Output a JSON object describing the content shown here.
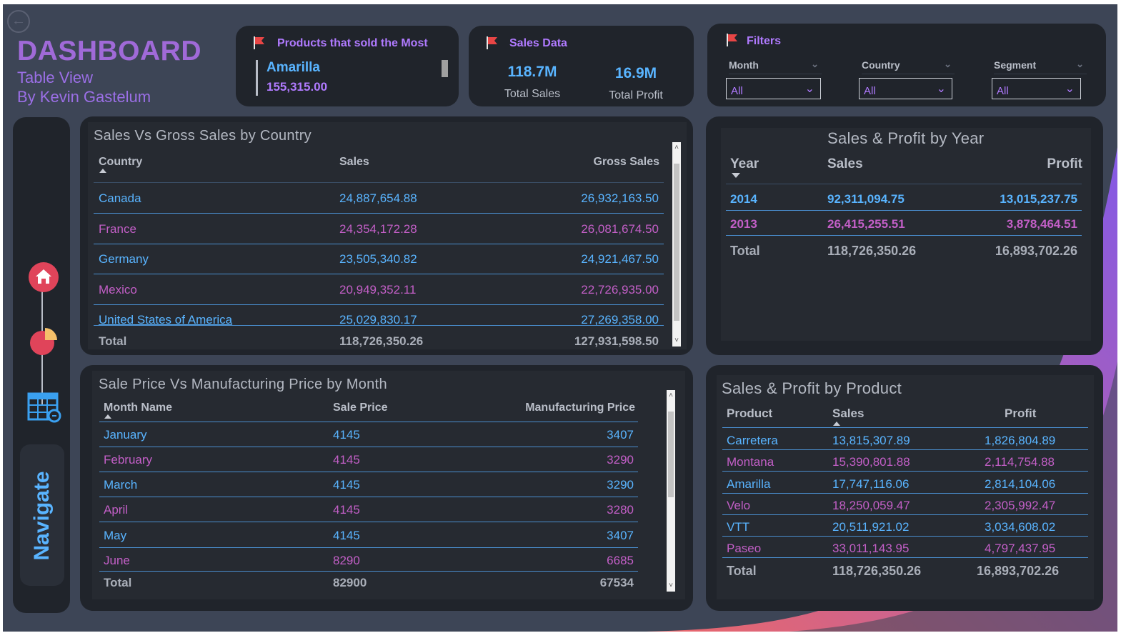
{
  "header": {
    "title": "DASHBOARD",
    "subtitle": "Table View",
    "author": "By Kevin Gastelum",
    "back_icon": "arrow-left-circle-icon"
  },
  "top_product": {
    "title": "Products that sold the Most",
    "name": "Amarilla",
    "value": "155,315.00"
  },
  "sales_data": {
    "title": "Sales Data",
    "total_sales_value": "118.7M",
    "total_sales_label": "Total Sales",
    "total_profit_value": "16.9M",
    "total_profit_label": "Total Profit"
  },
  "filters": {
    "title": "Filters",
    "items": [
      {
        "label": "Month",
        "value": "All"
      },
      {
        "label": "Country",
        "value": "All"
      },
      {
        "label": "Segment",
        "value": "All"
      }
    ]
  },
  "country_table": {
    "title": "Sales Vs Gross Sales by Country",
    "columns": [
      "Country",
      "Sales",
      "Gross Sales"
    ],
    "rows": [
      [
        "Canada",
        "24,887,654.88",
        "26,932,163.50"
      ],
      [
        "France",
        "24,354,172.28",
        "26,081,674.50"
      ],
      [
        "Germany",
        "23,505,340.82",
        "24,921,467.50"
      ],
      [
        "Mexico",
        "20,949,352.11",
        "22,726,935.00"
      ],
      [
        "United States of America",
        "25,029,830.17",
        "27,269,358.00"
      ]
    ],
    "total": [
      "Total",
      "118,726,350.26",
      "127,931,598.50"
    ]
  },
  "year_table": {
    "title": "Sales & Profit by Year",
    "columns": [
      "Year",
      "Sales",
      "Profit"
    ],
    "rows": [
      [
        "2014",
        "92,311,094.75",
        "13,015,237.75"
      ],
      [
        "2013",
        "26,415,255.51",
        "3,878,464.51"
      ]
    ],
    "total": [
      "Total",
      "118,726,350.26",
      "16,893,702.26"
    ]
  },
  "month_table": {
    "title": "Sale Price Vs Manufacturing Price by Month",
    "columns": [
      "Month Name",
      "Sale Price",
      "Manufacturing Price"
    ],
    "rows": [
      [
        "January",
        "4145",
        "3407"
      ],
      [
        "February",
        "4145",
        "3290"
      ],
      [
        "March",
        "4145",
        "3290"
      ],
      [
        "April",
        "4145",
        "3280"
      ],
      [
        "May",
        "4145",
        "3407"
      ],
      [
        "June",
        "8290",
        "6685"
      ]
    ],
    "total": [
      "Total",
      "82900",
      "67534"
    ]
  },
  "product_table": {
    "title": "Sales & Profit by Product",
    "columns": [
      "Product",
      "Sales",
      "Profit"
    ],
    "rows": [
      [
        "Carretera",
        "13,815,307.89",
        "1,826,804.89"
      ],
      [
        "Montana",
        "15,390,801.88",
        "2,114,754.88"
      ],
      [
        "Amarilla",
        "17,747,116.06",
        "2,814,104.06"
      ],
      [
        "Velo",
        "18,250,059.47",
        "2,305,992.47"
      ],
      [
        "VTT",
        "20,511,921.02",
        "3,034,608.02"
      ],
      [
        "Paseo",
        "33,011,143.95",
        "4,797,437.95"
      ]
    ],
    "total": [
      "Total",
      "118,726,350.26",
      "16,893,702.26"
    ]
  },
  "navigation": {
    "label": "Navigate",
    "icons": [
      "home-icon",
      "pie-chart-icon",
      "table-icon"
    ]
  },
  "colors": {
    "background": "#3d4556",
    "panel": "#20242b",
    "accent_purple": "#a06ad8",
    "row_blue": "#59b4ff",
    "row_pink": "#c35fc7",
    "divider": "#4a8fd0"
  }
}
